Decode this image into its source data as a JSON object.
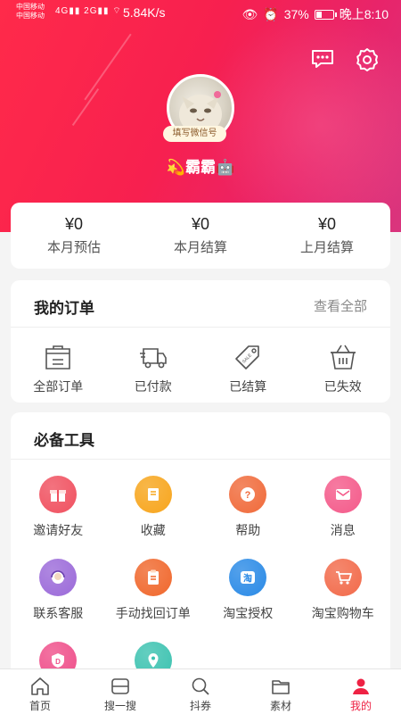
{
  "status_bar": {
    "carrier_1": "中国移动",
    "carrier_2": "中国移动",
    "network_1": "4G",
    "network_2": "2G",
    "speed": "5.84K/s",
    "battery": "37%",
    "battery_level": 0.37,
    "time": "晚上8:10"
  },
  "profile": {
    "wechat_tag": "填写微信号",
    "nickname": "霸霸"
  },
  "earnings": [
    {
      "value": "¥0",
      "label": "本月预估"
    },
    {
      "value": "¥0",
      "label": "本月结算"
    },
    {
      "value": "¥0",
      "label": "上月结算"
    }
  ],
  "orders": {
    "title": "我的订单",
    "view_all": "查看全部",
    "items": [
      {
        "label": "全部订单",
        "icon": "shopping-bag-icon"
      },
      {
        "label": "已付款",
        "icon": "delivery-truck-icon"
      },
      {
        "label": "已结算",
        "icon": "sale-tag-icon"
      },
      {
        "label": "已失效",
        "icon": "basket-icon"
      }
    ]
  },
  "tools": {
    "title": "必备工具",
    "items": [
      {
        "label": "邀请好友",
        "icon": "gift-icon",
        "color": "#f0505f"
      },
      {
        "label": "收藏",
        "icon": "book-icon",
        "color": "#f7a51c"
      },
      {
        "label": "帮助",
        "icon": "help-icon",
        "color": "#f06a3a"
      },
      {
        "label": "消息",
        "icon": "mail-icon",
        "color": "#f45a8a"
      },
      {
        "label": "联系客服",
        "icon": "service-icon",
        "color": "#9b6ad9"
      },
      {
        "label": "手动找回订单",
        "icon": "clipboard-icon",
        "color": "#f0672c"
      },
      {
        "label": "淘宝授权",
        "icon": "taobao-icon",
        "color": "#2a8ae6"
      },
      {
        "label": "淘宝购物车",
        "icon": "cart-icon",
        "color": "#f26a4a"
      },
      {
        "label": "",
        "icon": "shield-d-icon",
        "color": "#ef4f8a"
      },
      {
        "label": "",
        "icon": "location-icon",
        "color": "#3cc2b0"
      }
    ]
  },
  "tabbar": [
    {
      "label": "首页",
      "icon": "home-icon"
    },
    {
      "label": "搜一搜",
      "icon": "scan-icon"
    },
    {
      "label": "抖券",
      "icon": "search-icon"
    },
    {
      "label": "素材",
      "icon": "folder-icon"
    },
    {
      "label": "我的",
      "icon": "user-icon",
      "active": true
    }
  ],
  "colors": {
    "brand": "#f52248",
    "active_tab": "#ee2244"
  }
}
